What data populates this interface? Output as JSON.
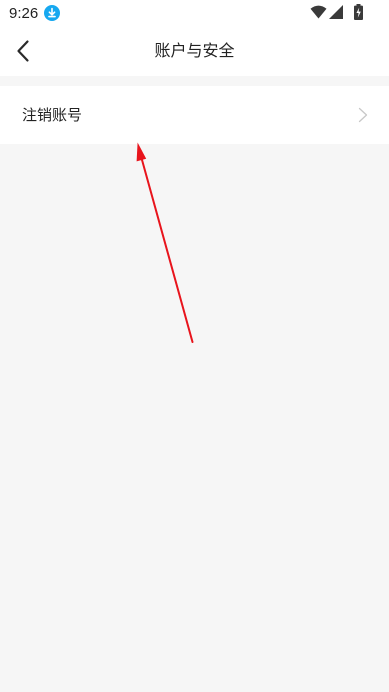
{
  "status_bar": {
    "time": "9:26",
    "icons": [
      "download-icon",
      "wifi-icon",
      "signal-icon",
      "battery-icon"
    ]
  },
  "nav": {
    "title": "账户与安全",
    "back_icon": "chevron-left-icon"
  },
  "list": {
    "items": [
      {
        "label": "注销账号",
        "icon": "chevron-right-icon"
      }
    ]
  },
  "colors": {
    "download_badge": "#16a8f0",
    "annotation_arrow": "#e8141c",
    "page_background": "#f6f6f6"
  }
}
